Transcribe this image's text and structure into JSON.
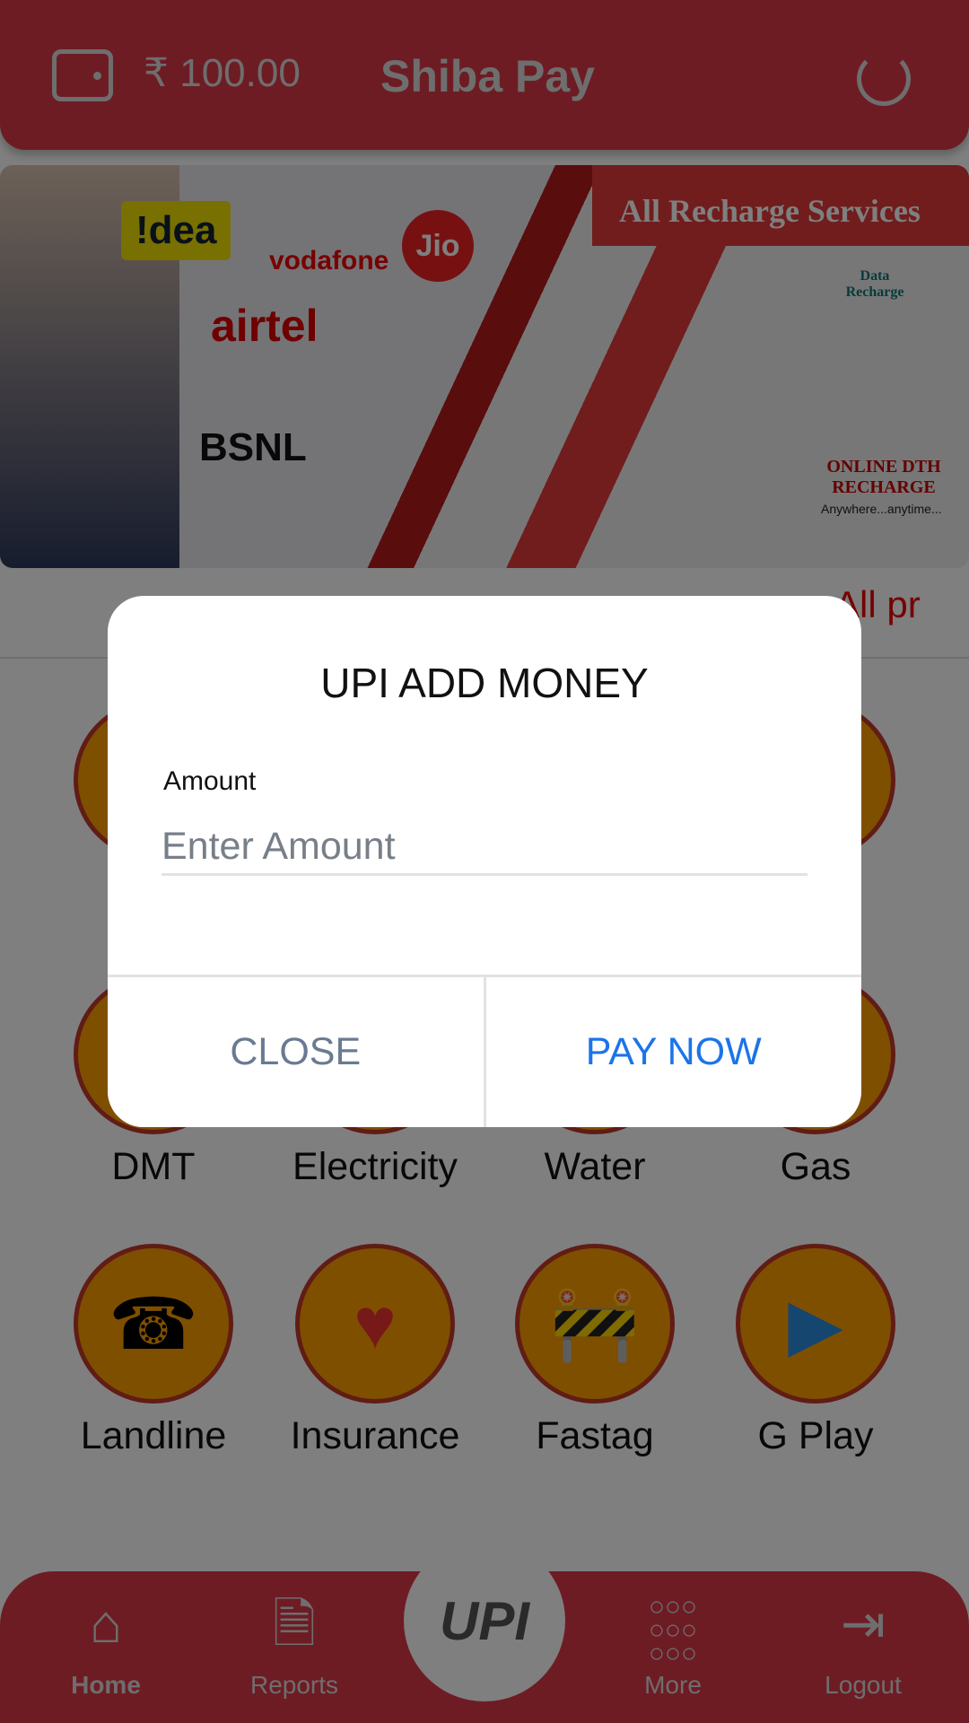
{
  "header": {
    "balance": "₹ 100.00",
    "title": "Shiba Pay",
    "wallet_icon": "wallet-icon",
    "refresh_icon": "refresh-icon",
    "color": "#dc3848"
  },
  "banner": {
    "headline": "All Recharge Services",
    "brands": [
      "!dea",
      "vodafone",
      "Jio",
      "airtel",
      "BSNL"
    ],
    "data_label": "Data Recharge",
    "dth_label": "ONLINE DTH RECHARGE",
    "tagline": "Anywhere...anytime..."
  },
  "marquee": "All pr",
  "services": [
    {
      "label": "DMT",
      "icon": "money-transfer-icon"
    },
    {
      "label": "Electricity",
      "icon": "electricity-icon"
    },
    {
      "label": "Water",
      "icon": "water-icon"
    },
    {
      "label": "Gas",
      "icon": "gas-icon"
    },
    {
      "label": "Landline",
      "icon": "telephone-icon"
    },
    {
      "label": "Insurance",
      "icon": "insurance-hands-heart-icon"
    },
    {
      "label": "Fastag",
      "icon": "toll-gate-icon"
    },
    {
      "label": "G Play",
      "icon": "google-play-icon"
    }
  ],
  "nav": {
    "items": [
      {
        "label": "Home",
        "icon": "home-icon"
      },
      {
        "label": "Reports",
        "icon": "document-icon"
      },
      {
        "label": "More",
        "icon": "grid-icon"
      },
      {
        "label": "Logout",
        "icon": "logout-icon"
      }
    ],
    "center": "UPI"
  },
  "modal": {
    "title": "UPI ADD MONEY",
    "amount_label": "Amount",
    "amount_placeholder": "Enter Amount",
    "amount_value": "",
    "close": "CLOSE",
    "pay": "PAY NOW",
    "pay_color": "#1c74e8"
  }
}
